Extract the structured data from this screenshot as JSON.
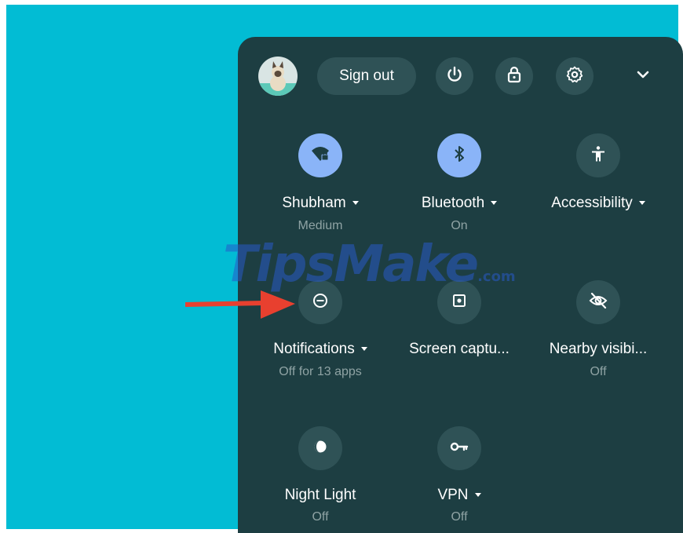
{
  "header": {
    "sign_out_label": "Sign out",
    "icons": [
      "power-icon",
      "lock-icon",
      "settings-gear-icon",
      "chevron-down-icon"
    ]
  },
  "tiles": [
    {
      "id": "wifi",
      "label": "Shubham",
      "sub": "Medium",
      "has_menu": true,
      "active": true,
      "icon": "wifi-locked-icon"
    },
    {
      "id": "bluetooth",
      "label": "Bluetooth",
      "sub": "On",
      "has_menu": true,
      "active": true,
      "icon": "bluetooth-icon"
    },
    {
      "id": "accessibility",
      "label": "Accessibility",
      "sub": "",
      "has_menu": true,
      "active": false,
      "icon": "accessibility-icon"
    },
    {
      "id": "notifications",
      "label": "Notifications",
      "sub": "Off for 13 apps",
      "has_menu": true,
      "active": false,
      "icon": "do-not-disturb-icon"
    },
    {
      "id": "screen-capture",
      "label": "Screen captu...",
      "sub": "",
      "has_menu": false,
      "active": false,
      "icon": "screen-capture-icon"
    },
    {
      "id": "nearby",
      "label": "Nearby visibi...",
      "sub": "Off",
      "has_menu": false,
      "active": false,
      "icon": "visibility-off-icon"
    },
    {
      "id": "night-light",
      "label": "Night Light",
      "sub": "Off",
      "has_menu": false,
      "active": false,
      "icon": "night-light-icon"
    },
    {
      "id": "vpn",
      "label": "VPN",
      "sub": "Off",
      "has_menu": true,
      "active": false,
      "icon": "vpn-key-icon"
    }
  ],
  "watermark": {
    "main": "TipsMake",
    "suffix": ".com"
  },
  "colors": {
    "desktop": "#02bcd4",
    "panel": "#1d3e42",
    "button": "#2f5256",
    "active": "#8ab4f8",
    "arrow": "#e8402f"
  }
}
